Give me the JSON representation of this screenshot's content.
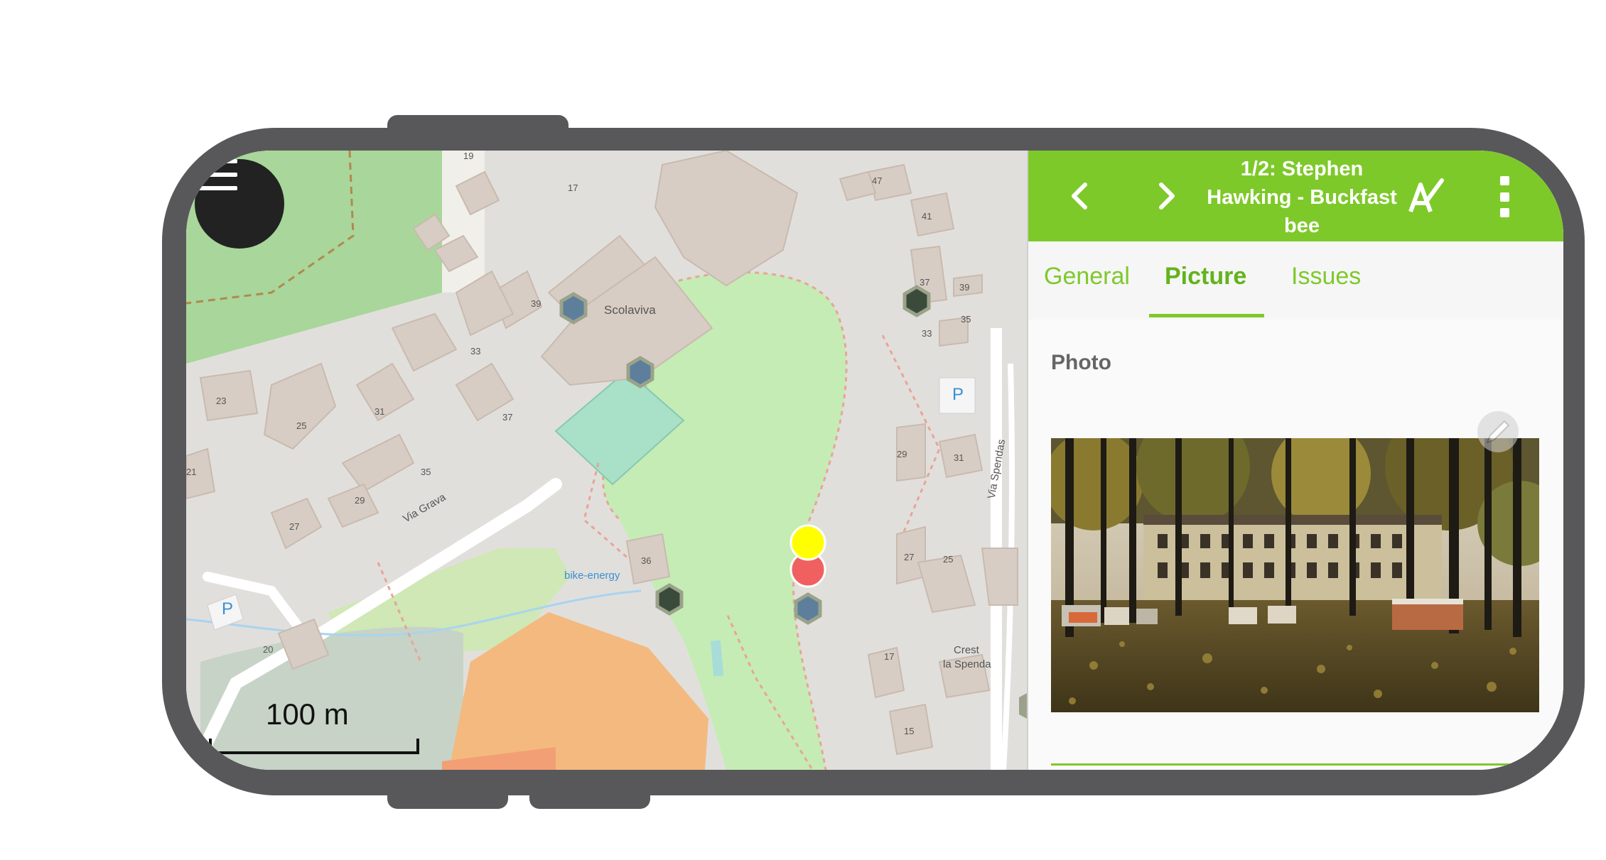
{
  "map": {
    "scale_label": "100 m",
    "labels": {
      "scolaviva": "Scolaviva",
      "via_grava": "Via Grava",
      "via_spendas": "Via Spendas",
      "bike_energy": "bike-energy",
      "crest": "Crest",
      "la_spenda": "la Spenda",
      "parking_a": "P",
      "parking_b": "P"
    },
    "house_numbers": [
      "17",
      "47",
      "41",
      "39",
      "37",
      "39",
      "35",
      "33",
      "33",
      "31",
      "23",
      "25",
      "37",
      "29",
      "31",
      "35",
      "21",
      "29",
      "27",
      "36",
      "27",
      "25",
      "17",
      "15",
      "20",
      "19"
    ],
    "markers": {
      "yellow": "#ffff00",
      "red": "#f06060"
    }
  },
  "panel": {
    "title": "1/2: Stephen Hawking - Buckfast bee",
    "tabs": [
      "General",
      "Picture",
      "Issues"
    ],
    "active_tab": "Picture",
    "section_label": "Photo",
    "accent": "#7ec92a"
  },
  "icons": {
    "menu": "hamburger-icon",
    "prev": "chevron-left-icon",
    "next": "chevron-right-icon",
    "edit": "edit-attributes-icon",
    "more": "more-vertical-icon",
    "pencil": "pencil-icon"
  }
}
